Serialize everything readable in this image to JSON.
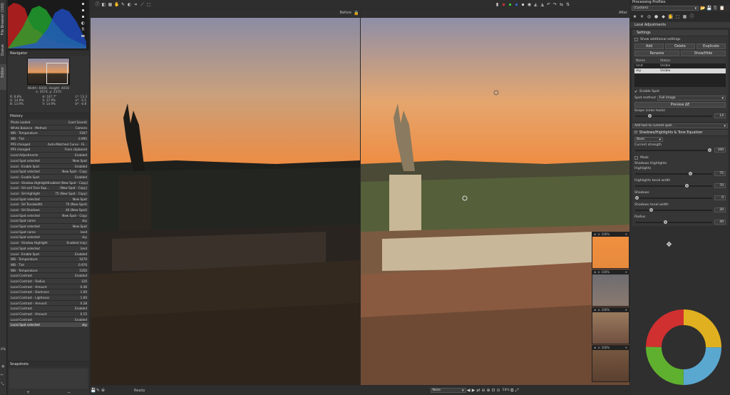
{
  "left_tabs": {
    "file_browser": "File Browser (100)",
    "queue": "Queue",
    "editor": "Editor"
  },
  "navigator": {
    "title": "Navigator",
    "size_info": "Width: 6000, Height: 4016",
    "coords": "x: 3574, y: 2370",
    "rgb": [
      {
        "k": "R:",
        "v": "8.8%"
      },
      {
        "k": "G:",
        "v": "14.9%"
      },
      {
        "k": "B:",
        "v": "13.9%"
      }
    ],
    "hsv": [
      {
        "k": "H:",
        "v": "167.7°"
      },
      {
        "k": "S:",
        "v": "37.9%"
      },
      {
        "k": "V:",
        "v": "14.9%"
      }
    ],
    "lab": [
      {
        "k": "L*:",
        "v": "13.3"
      },
      {
        "k": "a*:",
        "v": "-5.5"
      },
      {
        "k": "b*:",
        "v": "-0.8"
      }
    ]
  },
  "history": {
    "title": "History",
    "items": [
      {
        "a": "Photo loaded",
        "b": "(Last Saved)"
      },
      {
        "a": "White Balance - Method",
        "b": "Camera"
      },
      {
        "a": "WB - Temperature",
        "b": "5167"
      },
      {
        "a": "WB - Tint",
        "b": "0.995"
      },
      {
        "a": "PP3 changed",
        "b": "Auto-Matched Curve - IS..."
      },
      {
        "a": "PP3 changed",
        "b": "From clipboard"
      },
      {
        "a": "Local Adjustments",
        "b": "Enabled"
      },
      {
        "a": "Local Spot selected",
        "b": "New Spot"
      },
      {
        "a": "Local - Enable Spot",
        "b": "Enabled"
      },
      {
        "a": "Local Spot selected",
        "b": "New Spot - Copy"
      },
      {
        "a": "Local - Enable Spot",
        "b": "Enabled"
      },
      {
        "a": "Local - Shadow Highlight",
        "b": "Enabled (New Spot - Copy)"
      },
      {
        "a": "Local - SH and Tone Equ...",
        "b": "(New Spot - Copy)"
      },
      {
        "a": "Local - SH Highlight",
        "b": "75 (New Spot - Copy)"
      },
      {
        "a": "Local Spot selected",
        "b": "New Spot"
      },
      {
        "a": "Local - SH Tonalwidth",
        "b": "70 (New Spot)"
      },
      {
        "a": "Local - SH Shadows",
        "b": "40 (New Spot)"
      },
      {
        "a": "Local Spot selected",
        "b": "New Spot - Copy"
      },
      {
        "a": "Local Spot name",
        "b": "sky"
      },
      {
        "a": "Local Spot selected",
        "b": "New Spot"
      },
      {
        "a": "Local Spot name",
        "b": "land"
      },
      {
        "a": "Local Spot selected",
        "b": "sky"
      },
      {
        "a": "Local - Shadow Highlight",
        "b": "Enabled (sky)"
      },
      {
        "a": "Local Spot selected",
        "b": "land"
      },
      {
        "a": "Local - Enable Spot",
        "b": "Enabled"
      },
      {
        "a": "WB - Temperature",
        "b": "5470"
      },
      {
        "a": "WB - Tint",
        "b": "0.970"
      },
      {
        "a": "WB - Temperature",
        "b": "5350"
      },
      {
        "a": "Local Contrast",
        "b": "Enabled"
      },
      {
        "a": "Local Contrast - Radius",
        "b": "120"
      },
      {
        "a": "Local Contrast - Amount",
        "b": "0.46"
      },
      {
        "a": "Local Contrast - Darkness",
        "b": "1.00"
      },
      {
        "a": "Local Contrast - Lightness",
        "b": "1.00"
      },
      {
        "a": "Local Contrast - Amount",
        "b": "0.28"
      },
      {
        "a": "Local Contrast",
        "b": "Enabled"
      },
      {
        "a": "Local Contrast - Amount",
        "b": "0.15"
      },
      {
        "a": "Local Contrast",
        "b": "Enabled"
      },
      {
        "a": "Local Spot selected",
        "b": "sky"
      }
    ]
  },
  "snapshots": {
    "title": "Snapshots"
  },
  "left_zoom": "0%",
  "before_label": "Before",
  "after_label": "After",
  "status": {
    "ready": "Ready",
    "fit": "None",
    "zoom": "58%"
  },
  "preview_zoom": [
    "100%",
    "100%",
    "100%",
    "100%"
  ],
  "right": {
    "profiles_title": "Processing Profiles",
    "profile_value": "(Custom)",
    "panel_title": "Local Adjustments",
    "settings": "Settings",
    "show_additional": "Show additional settings",
    "btn_add": "Add",
    "btn_delete": "Delete",
    "btn_duplicate": "Duplicate",
    "btn_rename": "Rename",
    "btn_showhide": "Show/Hide",
    "col_name": "Name",
    "col_status": "Status",
    "spots": [
      {
        "name": "land",
        "status": "Visible"
      },
      {
        "name": "sky",
        "status": "Visible"
      }
    ],
    "enable_spot": "Enable Spot",
    "spot_method_label": "Spot method",
    "spot_method_value": "Full image",
    "preview_dE": "Preview ΔE",
    "scope_label": "Scope (color tools)",
    "scope_value": "14",
    "add_tool": "Add tool to current spot...",
    "sh_title": "Shadows/Highlights & Tone Equalizer",
    "basic": "Basic",
    "spot_strength": "Current strength",
    "spot_strength_val": "100",
    "mask": "Mask",
    "sh_sub": "Shadows Highlights",
    "sliders": [
      {
        "label": "Highlights",
        "value": "75",
        "pct": 0.75
      },
      {
        "label": "Highlights tonal width",
        "value": "70",
        "pct": 0.7
      },
      {
        "label": "Shadows",
        "value": "0",
        "pct": 0.0
      },
      {
        "label": "Shadows tonal width",
        "value": "20",
        "pct": 0.2
      },
      {
        "label": "Radius",
        "value": "40",
        "pct": 0.4
      }
    ]
  },
  "colors": {
    "bg": "#2b2b2b",
    "panel": "#333333",
    "selected": "#4a4a4a"
  }
}
